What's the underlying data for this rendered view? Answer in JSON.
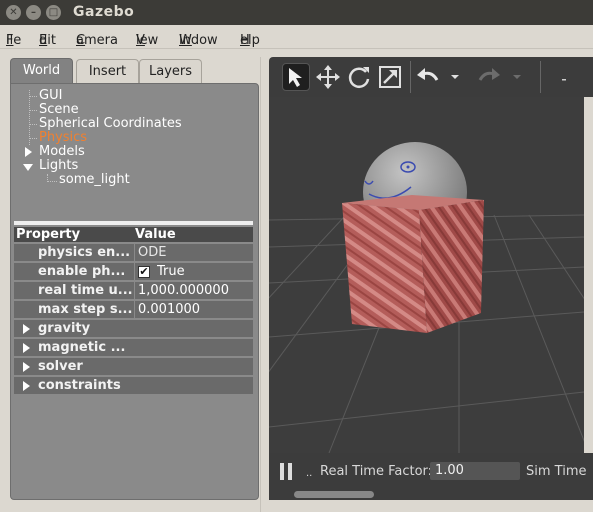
{
  "window": {
    "title": "Gazebo"
  },
  "menu": {
    "items": [
      {
        "label": "File",
        "mnemonic": "F",
        "rest": "ile"
      },
      {
        "label": "Edit",
        "mnemonic": "E",
        "rest": "dit"
      },
      {
        "label": "Camera",
        "mnemonic": "C",
        "rest": "amera"
      },
      {
        "label": "View",
        "mnemonic": "V",
        "rest": "iew"
      },
      {
        "label": "Window",
        "mnemonic": "W",
        "rest": "indow"
      },
      {
        "label": "Help",
        "mnemonic": "H",
        "rest": "elp"
      }
    ]
  },
  "left_panel": {
    "tabs": [
      {
        "label": "World",
        "active": true
      },
      {
        "label": "Insert",
        "active": false
      },
      {
        "label": "Layers",
        "active": false
      }
    ],
    "tree": {
      "gui": "GUI",
      "scene": "Scene",
      "spherical": "Spherical Coordinates",
      "physics": "Physics",
      "models": "Models",
      "lights": "Lights",
      "light_child": "some_light"
    },
    "properties": {
      "header_property": "Property",
      "header_value": "Value",
      "rows": [
        {
          "name": "physics en...",
          "value": "ODE"
        },
        {
          "name": "enable ph...",
          "value": "True",
          "checked": true
        },
        {
          "name": "real time u...",
          "value": "1,000.000000"
        },
        {
          "name": "max step s...",
          "value": "0.001000"
        }
      ],
      "groups": [
        "gravity",
        "magnetic ...",
        "solver",
        "constraints"
      ]
    }
  },
  "toolbar": {
    "tools": [
      "select-arrow-icon",
      "translate-icon",
      "rotate-icon",
      "scale-icon",
      "undo-icon",
      "undo-dropdown-icon",
      "redo-icon",
      "redo-dropdown-icon"
    ],
    "selected_tool": "select-arrow-icon"
  },
  "bottom_bar": {
    "dots": "..",
    "rtf_label": "Real Time Factor:",
    "rtf_value": "1.00",
    "sim_time_label": "Sim Time"
  },
  "colors": {
    "titlebar": "#3c3b37",
    "panel": "#8a8a8a",
    "selected_tree": "#f08030",
    "viewport": "#3d3d3d",
    "box": "#a8504f",
    "sphere": "#9a9a9a"
  }
}
